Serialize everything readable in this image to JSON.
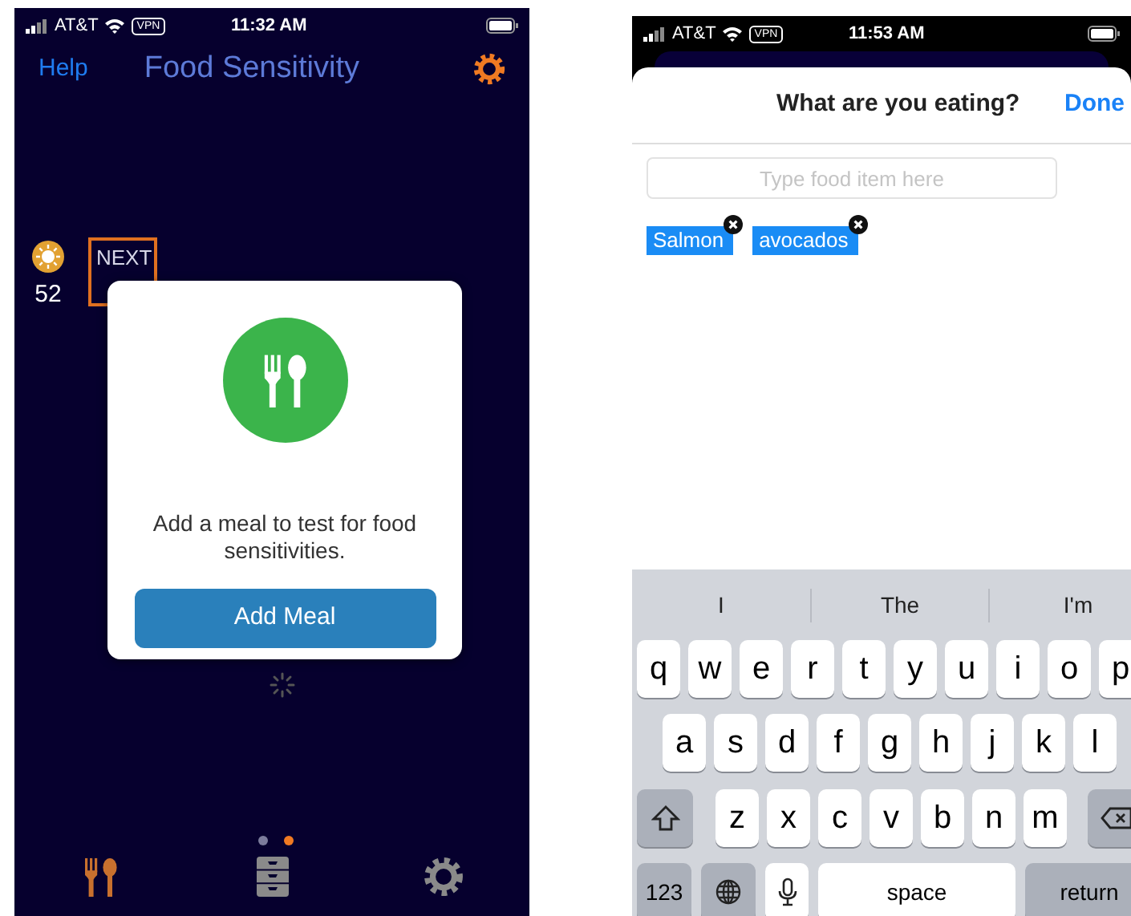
{
  "left_screen": {
    "status_bar": {
      "carrier": "AT&T",
      "vpn": "VPN",
      "time": "11:32 AM"
    },
    "header": {
      "help": "Help",
      "title": "Food Sensitivity"
    },
    "score": {
      "value": "52"
    },
    "next_step": {
      "label": "NEXT"
    },
    "dialog": {
      "message": "Add a meal to test for food sensitivities.",
      "button": "Add Meal"
    },
    "page_dots": [
      {
        "selected": false
      },
      {
        "selected": true
      }
    ],
    "tab_bar": [
      {
        "kind": "food",
        "selected": true
      },
      {
        "kind": "history",
        "selected": false
      },
      {
        "kind": "general",
        "selected": false
      }
    ]
  },
  "right_screen": {
    "status_bar": {
      "carrier": "AT&T",
      "vpn": "VPN",
      "time": "11:53 AM"
    },
    "sheet": {
      "title": "What are you eating?",
      "done": "Done"
    },
    "search": {
      "placeholder": "Type food item here"
    },
    "chips": [
      {
        "label": "Salmon"
      },
      {
        "label": "avocados"
      }
    ],
    "keyboard": {
      "suggestions": [
        "I",
        "The",
        "I'm"
      ],
      "rows": [
        [
          "q",
          "w",
          "e",
          "r",
          "t",
          "y",
          "u",
          "i",
          "o",
          "p"
        ],
        [
          "a",
          "s",
          "d",
          "f",
          "g",
          "h",
          "j",
          "k",
          "l"
        ],
        [
          "z",
          "x",
          "c",
          "v",
          "b",
          "n",
          "m"
        ]
      ],
      "number_key": "123",
      "space_key": "space",
      "return_key": "return"
    }
  }
}
